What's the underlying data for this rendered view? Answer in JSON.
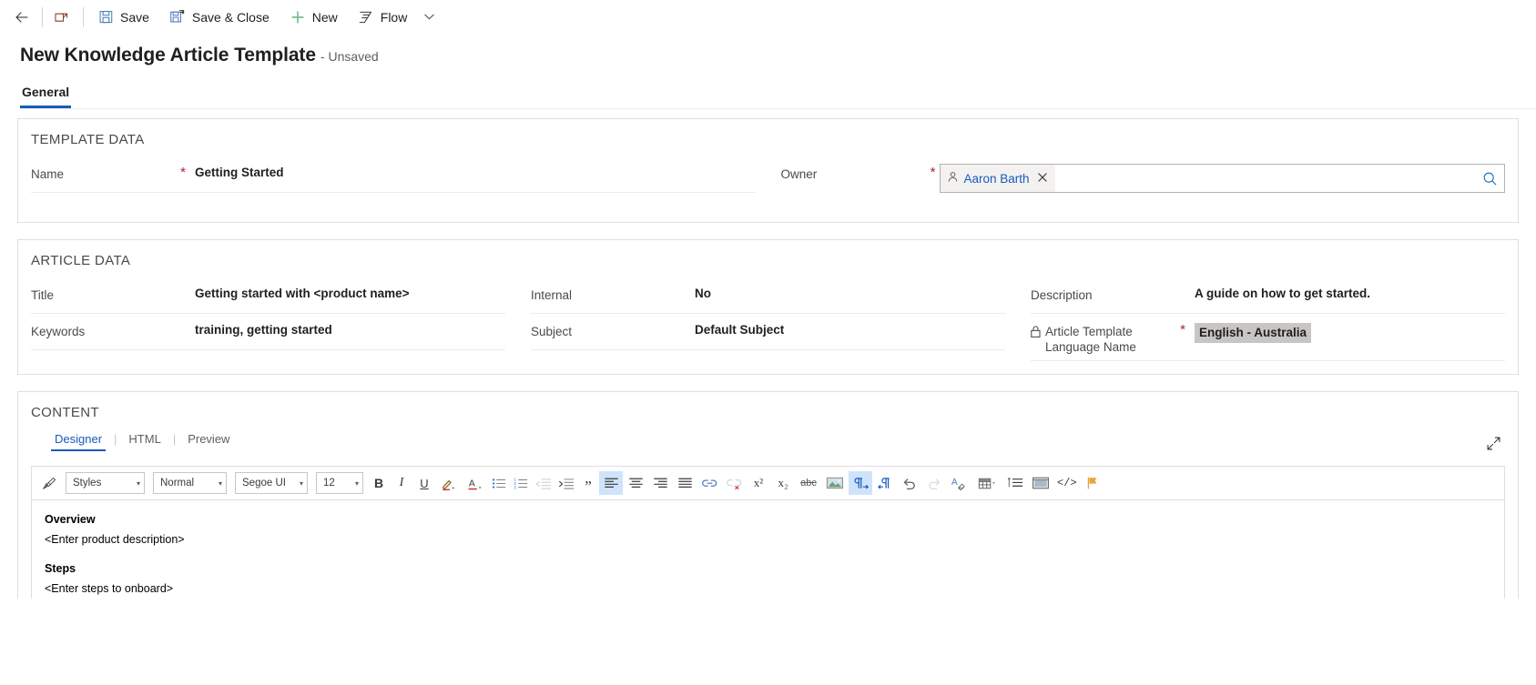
{
  "commandbar": {
    "back_label": "",
    "back_icon": "back-arrow-icon",
    "popout_icon": "open-in-new-window-icon",
    "save_label": "Save",
    "save_icon": "save-icon",
    "save_close_label": "Save & Close",
    "save_close_icon": "save-and-close-icon",
    "new_label": "New",
    "new_icon": "plus-icon",
    "flow_label": "Flow",
    "flow_icon": "flow-icon",
    "overflow_icon": "chevron-down-icon"
  },
  "record": {
    "title": "New Knowledge Article Template",
    "state": "- Unsaved"
  },
  "tabs": [
    {
      "label": "General",
      "selected": true
    }
  ],
  "template_data": {
    "section_label": "TEMPLATE DATA",
    "name": {
      "label": "Name",
      "required": "*",
      "value": "Getting Started"
    },
    "owner": {
      "label": "Owner",
      "required": "*",
      "value": "Aaron Barth",
      "chip_icon": "person-icon",
      "remove_icon": "close-icon",
      "search_icon": "lookup-search-icon"
    }
  },
  "article_data": {
    "section_label": "ARTICLE DATA",
    "fields_col1": [
      {
        "label": "Title",
        "value": "Getting started with <product name>"
      },
      {
        "label": "Keywords",
        "value": "training, getting started"
      }
    ],
    "fields_col2": [
      {
        "label": "Internal",
        "value": "No"
      },
      {
        "label": "Subject",
        "value": "Default Subject"
      }
    ],
    "fields_col3": [
      {
        "label": "Description",
        "value": "A guide on how to get started."
      }
    ],
    "language": {
      "label_line1": "Article Template",
      "label_line2": "Language Name",
      "required": "*",
      "lock_icon": "lock-icon",
      "value": "English - Australia"
    }
  },
  "content": {
    "section_label": "CONTENT",
    "expand_icon": "expand-diagonal-icon",
    "editor_tabs": [
      {
        "label": "Designer",
        "selected": true
      },
      {
        "label": "HTML",
        "selected": false
      },
      {
        "label": "Preview",
        "selected": false
      }
    ],
    "toolbar": {
      "format_painter_icon": "format-painter-icon",
      "styles": {
        "value": "Styles",
        "caret": "▾"
      },
      "format": {
        "value": "Normal",
        "caret": "▾"
      },
      "font": {
        "value": "Segoe UI",
        "caret": "▾"
      },
      "size": {
        "value": "12",
        "caret": "▾"
      },
      "bold_label": "B",
      "italic_label": "I",
      "underline_label": "U",
      "highlight_icon": "text-highlight-icon",
      "fontcolor_icon": "font-color-icon",
      "bullets_icon": "bulleted-list-icon",
      "numbering_icon": "numbered-list-icon",
      "outdent_icon": "decrease-indent-icon",
      "indent_icon": "increase-indent-icon",
      "blockquote_icon": "block-quote-icon",
      "align_left_icon": "align-left-icon",
      "align_center_icon": "align-center-icon",
      "align_right_icon": "align-right-icon",
      "justify_icon": "justify-icon",
      "link_icon": "insert-link-icon",
      "unlink_icon": "remove-link-icon",
      "superscript_label": "x²",
      "subscript_label": "x₂",
      "strikethrough_label": "abc",
      "image_icon": "insert-image-icon",
      "ltr_icon": "left-to-right-icon",
      "rtl_icon": "right-to-left-icon",
      "undo_icon": "undo-icon",
      "redo_icon": "redo-icon",
      "clear_format_icon": "clear-formatting-icon",
      "table_icon": "insert-table-icon",
      "line_spacing_icon": "line-spacing-icon",
      "insert_media_icon": "insert-media-icon",
      "source_code_icon": "source-code-icon",
      "flag_icon": "flag-icon"
    },
    "body": [
      {
        "type": "heading",
        "text": "Overview"
      },
      {
        "type": "paragraph",
        "text": "<Enter product description>"
      },
      {
        "type": "spacer",
        "text": ""
      },
      {
        "type": "heading",
        "text": "Steps"
      },
      {
        "type": "paragraph",
        "text": "<Enter steps to onboard>"
      }
    ]
  },
  "colors": {
    "accent": "#185abd",
    "link": "#185abd",
    "required": "#a4262c",
    "new_green": "#76c18a",
    "toolbar_active": "#cfe4fa",
    "highlight_bg": "#c8c6c4"
  }
}
